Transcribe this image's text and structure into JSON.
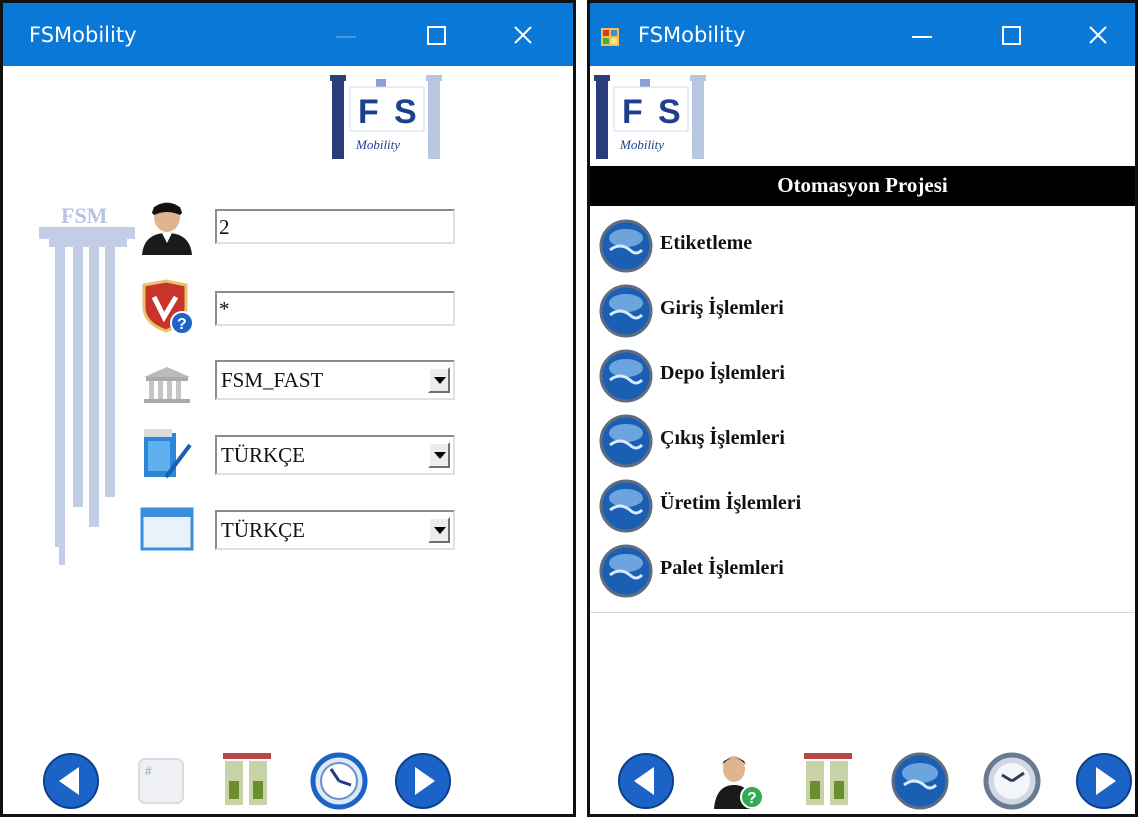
{
  "left_window": {
    "title": "FSMobility",
    "logo_letters": [
      "F",
      "S"
    ],
    "logo_subtitle": "Mobility",
    "watermark_text": "FSM",
    "user_field_value": "2",
    "password_field_value": "*",
    "database_select_value": "FSM_FAST",
    "language_select_value": "TÜRKÇE",
    "language2_select_value": "TÜRKÇE"
  },
  "right_window": {
    "title": "FSMobility",
    "logo_letters": [
      "F",
      "S"
    ],
    "logo_subtitle": "Mobility",
    "header": "Otomasyon Projesi",
    "menu_items": [
      {
        "label": "Etiketleme"
      },
      {
        "label": "Giriş İşlemleri"
      },
      {
        "label": "Depo İşlemleri"
      },
      {
        "label": "Çıkış İşlemleri"
      },
      {
        "label": "Üretim İşlemleri"
      },
      {
        "label": "Palet İşlemleri"
      }
    ]
  },
  "colors": {
    "titlebar": "#0a78d7",
    "header_bg": "#000000",
    "accent_blue": "#1c63c8"
  }
}
